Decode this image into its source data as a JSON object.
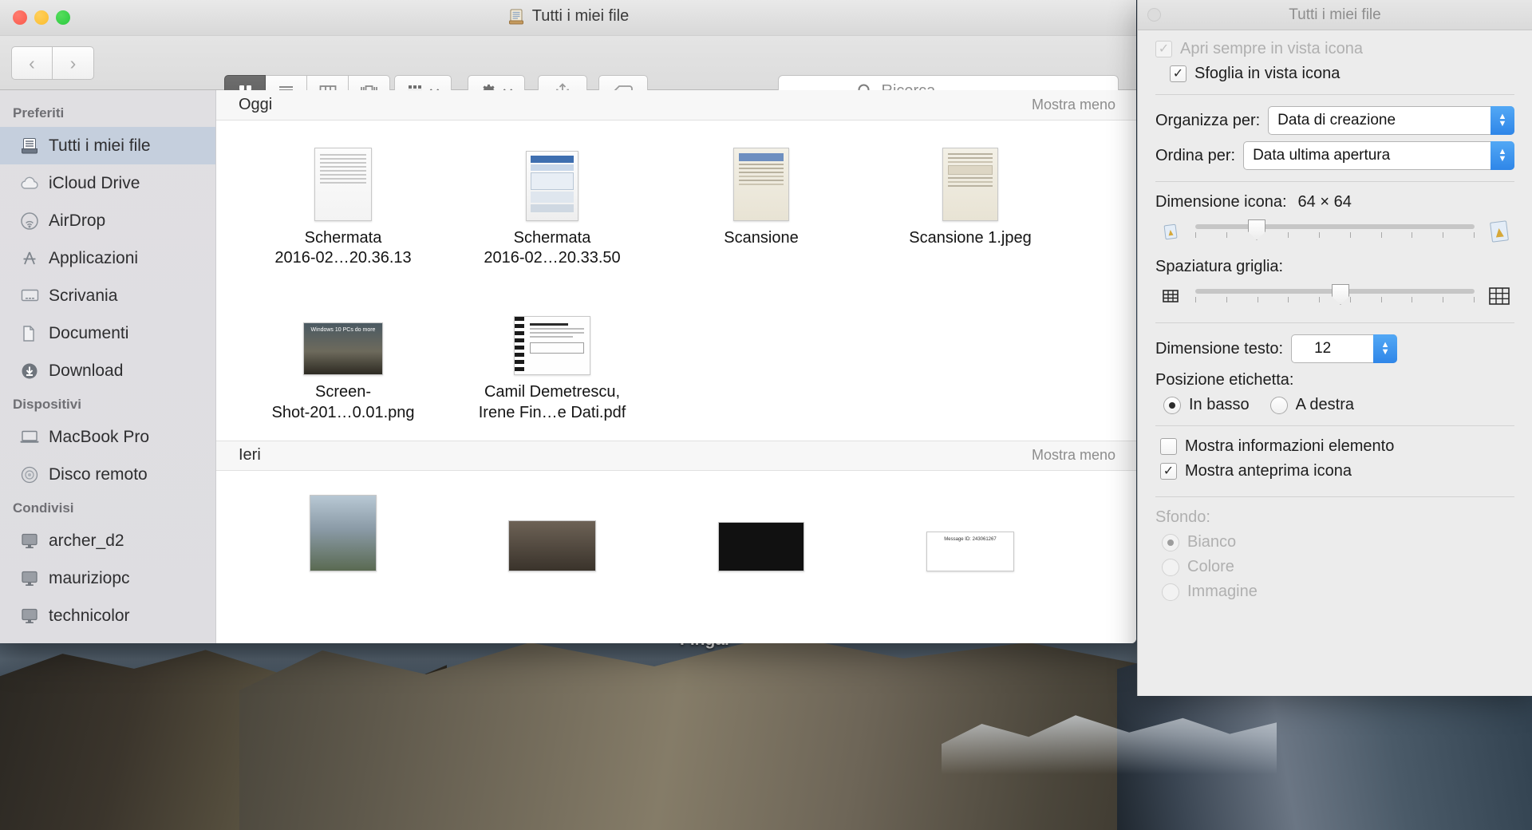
{
  "desktop": {
    "label": "Fingal"
  },
  "window": {
    "title": "Tutti i miei file",
    "title_icon": "all-my-files-icon",
    "traffic": {
      "close": "close-button",
      "minimize": "minimize-button",
      "maximize": "maximize-button"
    }
  },
  "toolbar": {
    "back": "back-button",
    "forward": "forward-button",
    "views": [
      {
        "name": "icon-view",
        "selected": true
      },
      {
        "name": "list-view",
        "selected": false
      },
      {
        "name": "column-view",
        "selected": false
      },
      {
        "name": "coverflow-view",
        "selected": false
      }
    ],
    "arrange": "arrange-button",
    "action": "action-gear-button",
    "share": "share-button",
    "tag": "tag-button"
  },
  "search": {
    "placeholder": "Ricerca",
    "value": ""
  },
  "sidebar": {
    "sections": [
      {
        "header": "Preferiti",
        "items": [
          {
            "label": "Tutti i miei file",
            "icon": "all-my-files-icon",
            "selected": true
          },
          {
            "label": "iCloud Drive",
            "icon": "cloud-icon",
            "selected": false
          },
          {
            "label": "AirDrop",
            "icon": "airdrop-icon",
            "selected": false
          },
          {
            "label": "Applicazioni",
            "icon": "applications-icon",
            "selected": false
          },
          {
            "label": "Scrivania",
            "icon": "desktop-icon",
            "selected": false
          },
          {
            "label": "Documenti",
            "icon": "documents-icon",
            "selected": false
          },
          {
            "label": "Download",
            "icon": "downloads-icon",
            "selected": false
          }
        ]
      },
      {
        "header": "Dispositivi",
        "items": [
          {
            "label": "MacBook Pro",
            "icon": "laptop-icon",
            "selected": false
          },
          {
            "label": "Disco remoto",
            "icon": "disc-icon",
            "selected": false
          }
        ]
      },
      {
        "header": "Condivisi",
        "items": [
          {
            "label": "archer_d2",
            "icon": "display-icon",
            "selected": false
          },
          {
            "label": "mauriziopc",
            "icon": "display-icon",
            "selected": false
          },
          {
            "label": "technicolor",
            "icon": "display-icon",
            "selected": false
          }
        ]
      }
    ]
  },
  "files": {
    "groups": [
      {
        "header": "Oggi",
        "showless": "Mostra meno",
        "rows": [
          [
            {
              "name": "Schermata\n2016-02…20.36.13",
              "line1": "Schermata",
              "line2": "2016-02…20.36.13",
              "thumb": "th-doc"
            },
            {
              "name": "Schermata\n2016-02…20.33.50",
              "line1": "Schermata",
              "line2": "2016-02…20.33.50",
              "thumb": "th-win"
            },
            {
              "name": "Scansione",
              "line1": "Scansione",
              "line2": "",
              "thumb": "th-scan"
            },
            {
              "name": "Scansione 1.jpeg",
              "line1": "Scansione 1.jpeg",
              "line2": "",
              "thumb": "th-scan"
            }
          ],
          [
            {
              "name": "Screen-Shot-201…0.01.png",
              "line1": "Screen-",
              "line2": "Shot-201…0.01.png",
              "thumb": "th-shot"
            },
            {
              "name": "Camil Demetrescu, Irene Fin…e Dati.pdf",
              "line1": "Camil Demetrescu,",
              "line2": "Irene Fin…e Dati.pdf",
              "thumb": "th-pdf"
            }
          ]
        ]
      },
      {
        "header": "Ieri",
        "showless": "Mostra meno",
        "rows": [
          [
            {
              "name": "",
              "line1": "",
              "line2": "",
              "thumb": "th-person"
            },
            {
              "name": "",
              "line1": "",
              "line2": "",
              "thumb": "th-photo"
            },
            {
              "name": "",
              "line1": "",
              "line2": "",
              "thumb": "th-dark"
            },
            {
              "name": "",
              "line1": "",
              "line2": "",
              "thumb": "th-mail"
            }
          ]
        ]
      }
    ]
  },
  "view_options": {
    "title": "Tutti i miei file",
    "always_open_icon_view": {
      "label": "Apri sempre in vista icona",
      "checked": true,
      "enabled": false
    },
    "browse_icon_view": {
      "label": "Sfoglia in vista icona",
      "checked": true,
      "enabled": true
    },
    "organize_by": {
      "label": "Organizza per:",
      "value": "Data di creazione"
    },
    "sort_by": {
      "label": "Ordina per:",
      "value": "Data ultima apertura"
    },
    "icon_size": {
      "label": "Dimensione icona:",
      "value": "64 × 64",
      "percent": 22
    },
    "grid_spacing": {
      "label": "Spaziatura griglia:",
      "percent": 52
    },
    "text_size": {
      "label": "Dimensione testo:",
      "value": "12"
    },
    "label_position": {
      "label": "Posizione etichetta:",
      "options": [
        {
          "label": "In basso",
          "selected": true
        },
        {
          "label": "A destra",
          "selected": false
        }
      ]
    },
    "show_item_info": {
      "label": "Mostra informazioni elemento",
      "checked": false
    },
    "show_icon_preview": {
      "label": "Mostra anteprima icona",
      "checked": true
    },
    "background": {
      "label": "Sfondo:",
      "options": [
        {
          "label": "Bianco",
          "selected": true
        },
        {
          "label": "Colore",
          "selected": false
        },
        {
          "label": "Immagine",
          "selected": false
        }
      ]
    }
  },
  "colors": {
    "accent": "#2f86e8",
    "selection": "#c5cfdd",
    "mail_text": "Message ID: 243061267"
  }
}
